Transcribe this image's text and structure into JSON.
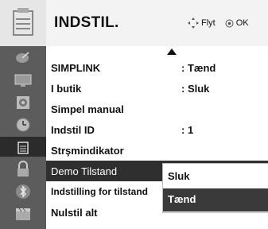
{
  "header": {
    "title": "INDSTIL.",
    "hint_move": "Flyt",
    "hint_ok": "OK",
    "icon": "settings-box-icon"
  },
  "sidebar": {
    "icons": [
      "satellite-dish-icon",
      "tv-screen-icon",
      "speaker-icon",
      "clock-icon",
      "settings-box-icon",
      "lock-icon",
      "bluetooth-icon",
      "clapperboard-icon"
    ],
    "active_index": 4
  },
  "menu": {
    "items": [
      {
        "label": "SIMPLINK",
        "value": ": Tænd"
      },
      {
        "label": "I butik",
        "value": ": Sluk"
      },
      {
        "label": "Simpel manual",
        "value": ""
      },
      {
        "label": "Indstil ID",
        "value": ": 1"
      },
      {
        "label": "Strşmindikator",
        "value": ""
      },
      {
        "label": "Demo Tilstand",
        "value": ""
      },
      {
        "label": "Indstilling for tilstand",
        "value": ""
      },
      {
        "label": "Nulstil alt",
        "value": ""
      }
    ],
    "selected_index": 5
  },
  "dropdown": {
    "options": [
      "Sluk",
      "Tænd"
    ],
    "selected_index": 1
  },
  "colors": {
    "sidebar": "#5c5c5c",
    "selected": "#2f2f2f",
    "header": "#f3f3f3"
  }
}
